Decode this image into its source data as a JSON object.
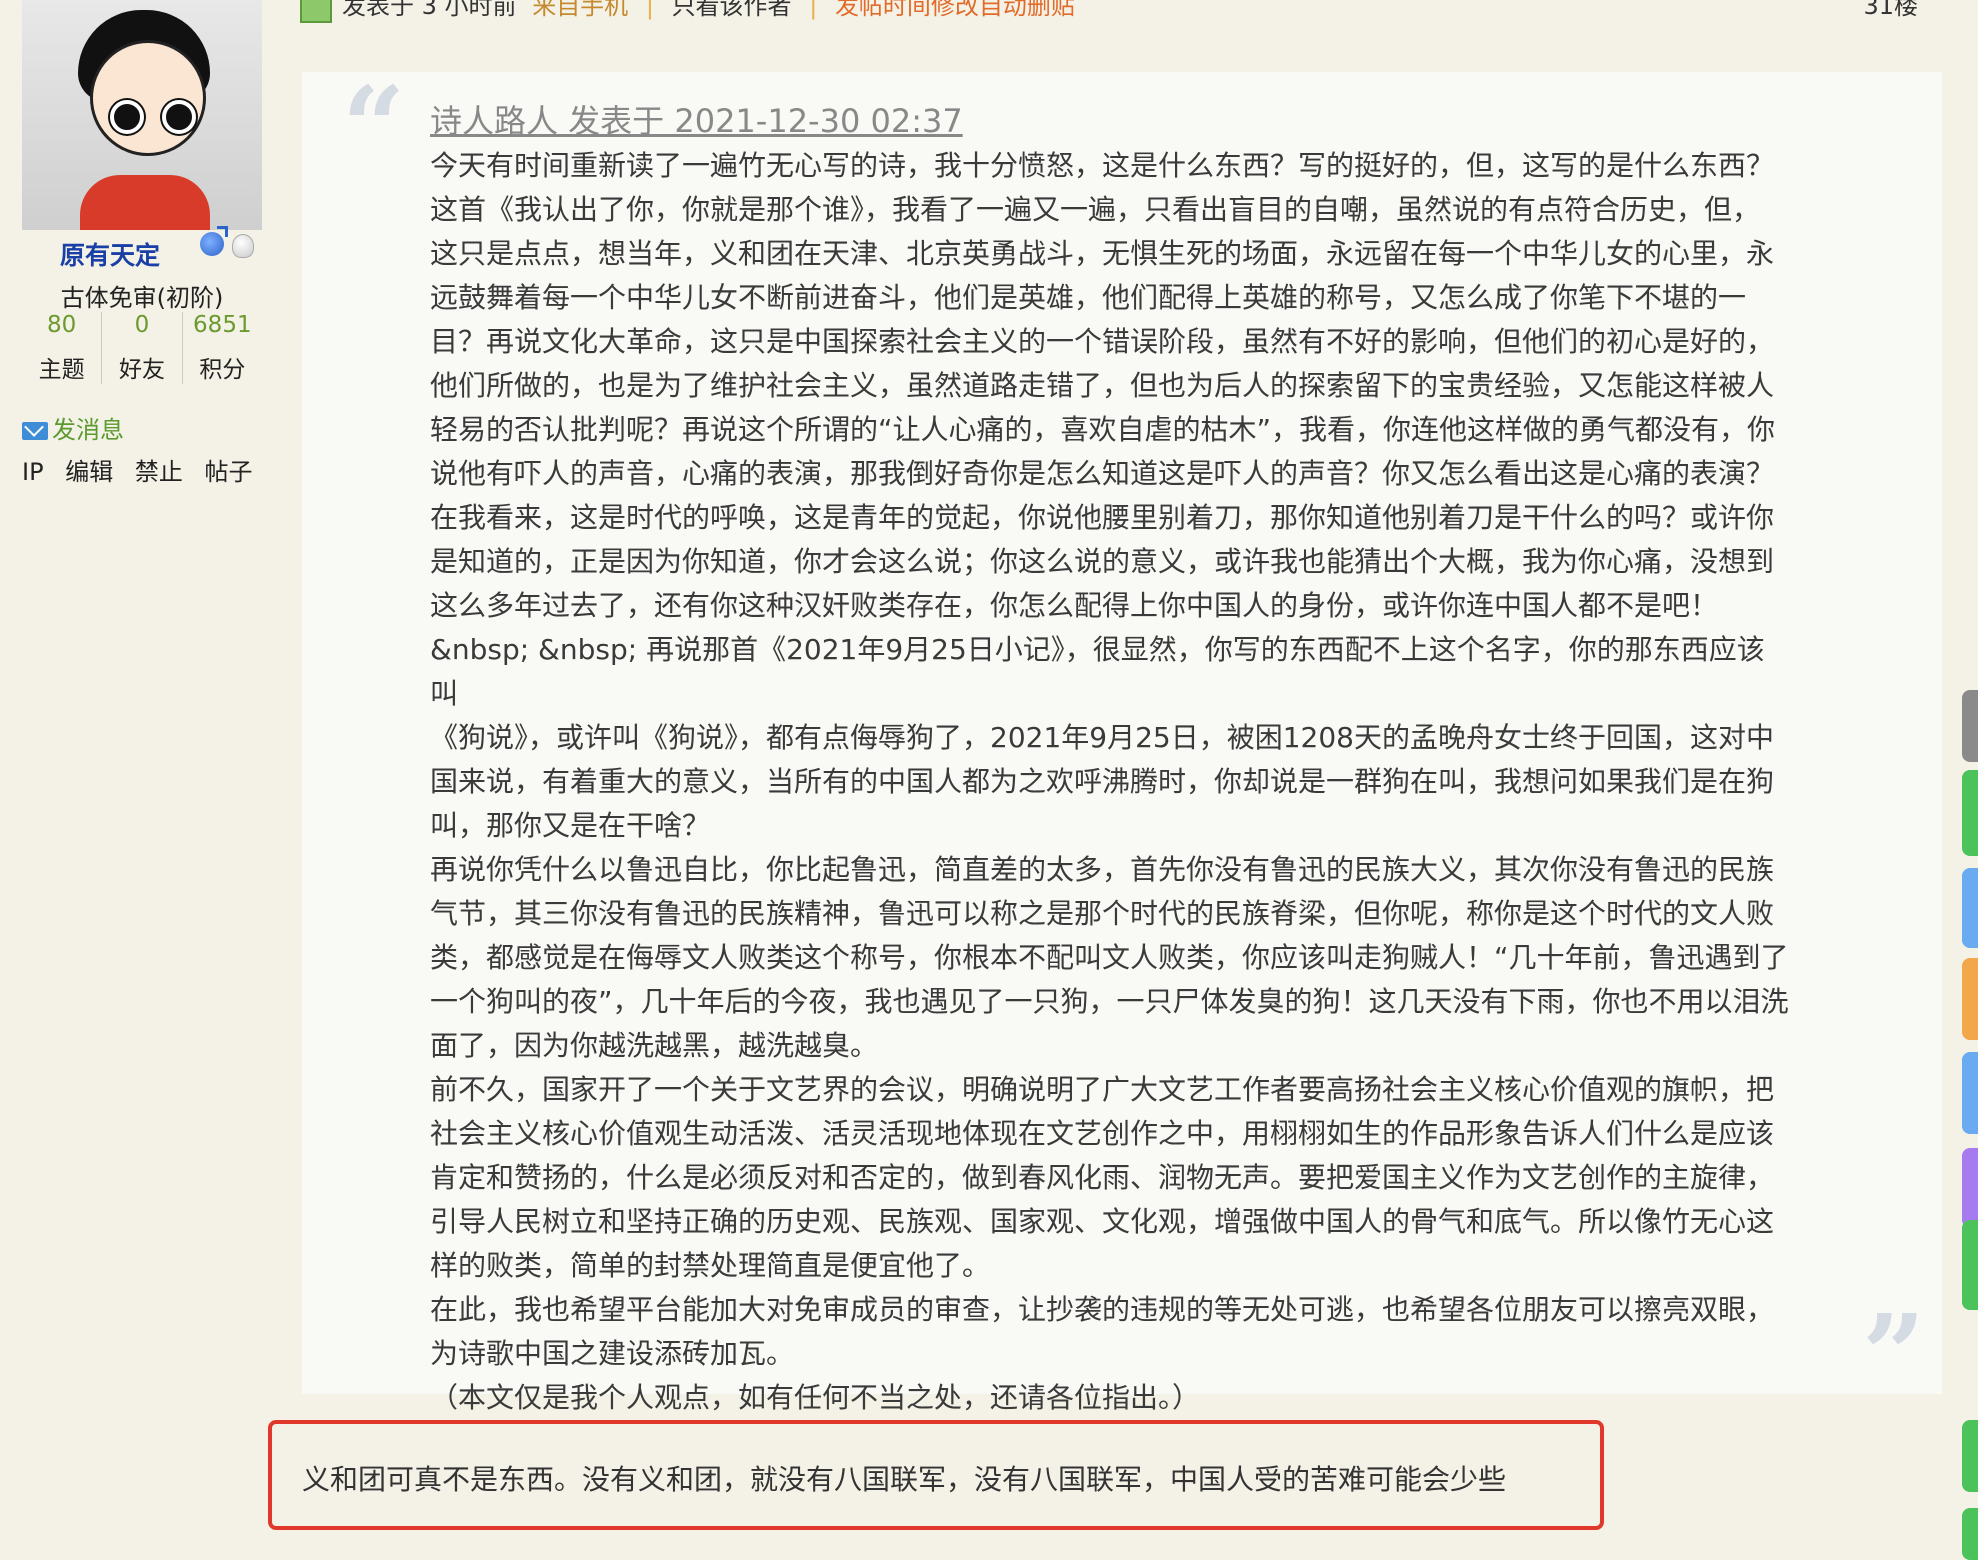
{
  "post_meta": {
    "posted_prefix": "发表于",
    "time_ago": "3 小时前",
    "source": "来自手机",
    "separator": "|",
    "only_author": "只看该作者",
    "edit_notice": "发帖时间修改自动删贴",
    "floor": "31楼"
  },
  "user": {
    "name": "原有天定",
    "rank": "古体免审(初阶)",
    "stats": [
      {
        "value": "80",
        "label": "主题"
      },
      {
        "value": "0",
        "label": "好友"
      },
      {
        "value": "6851",
        "label": "积分"
      }
    ],
    "send_message": "发消息",
    "admin_links": [
      "IP",
      "编辑",
      "禁止",
      "帖子"
    ]
  },
  "quote": {
    "header": "诗人路人 发表于 2021-12-30 02:37",
    "lines": [
      "今天有时间重新读了一遍竹无心写的诗，我十分愤怒，这是什么东西？写的挺好的，但，这写的是什么东西？",
      "这首《我认出了你，你就是那个谁》，我看了一遍又一遍，只看出盲目的自嘲，虽然说的有点符合历史，但，",
      "这只是点点，想当年，义和团在天津、北京英勇战斗，无惧生死的场面，永远留在每一个中华儿女的心里，永",
      "远鼓舞着每一个中华儿女不断前进奋斗，他们是英雄，他们配得上英雄的称号，又怎么成了你笔下不堪的一",
      "目？再说文化大革命，这只是中国探索社会主义的一个错误阶段，虽然有不好的影响，但他们的初心是好的，",
      "他们所做的，也是为了维护社会主义，虽然道路走错了，但也为后人的探索留下的宝贵经验，又怎能这样被人",
      "轻易的否认批判呢？再说这个所谓的“让人心痛的，喜欢自虐的枯木”，我看，你连他这样做的勇气都没有，你",
      "说他有吓人的声音，心痛的表演，那我倒好奇你是怎么知道这是吓人的声音？你又怎么看出这是心痛的表演？",
      "在我看来，这是时代的呼唤，这是青年的觉起，你说他腰里别着刀，那你知道他别着刀是干什么的吗？或许你",
      "是知道的，正是因为你知道，你才会这么说；你这么说的意义，或许我也能猜出个大概，我为你心痛，没想到",
      "这么多年过去了，还有你这种汉奸败类存在，你怎么配得上你中国人的身份，或许你连中国人都不是吧！",
      "&nbsp; &nbsp; 再说那首《2021年9月25日小记》，很显然，你写的东西配不上这个名字，你的那东西应该叫",
      "《狗说》，或许叫《狗说》，都有点侮辱狗了，2021年9月25日，被困1208天的孟晚舟女士终于回国，这对中",
      "国来说，有着重大的意义，当所有的中国人都为之欢呼沸腾时，你却说是一群狗在叫，我想问如果我们是在狗",
      "叫，那你又是在干啥？",
      "再说你凭什么以鲁迅自比，你比起鲁迅，简直差的太多，首先你没有鲁迅的民族大义，其次你没有鲁迅的民族",
      "气节，其三你没有鲁迅的民族精神，鲁迅可以称之是那个时代的民族脊梁，但你呢，称你是这个时代的文人败",
      "类，都感觉是在侮辱文人败类这个称号，你根本不配叫文人败类，你应该叫走狗贼人！“几十年前，鲁迅遇到了",
      "一个狗叫的夜”，几十年后的今夜，我也遇见了一只狗，一只尸体发臭的狗！这几天没有下雨，你也不用以泪洗",
      "面了，因为你越洗越黑，越洗越臭。",
      "前不久，国家开了一个关于文艺界的会议，明确说明了广大文艺工作者要高扬社会主义核心价值观的旗帜，把",
      "社会主义核心价值观生动活泼、活灵活现地体现在文艺创作之中，用栩栩如生的作品形象告诉人们什么是应该",
      "肯定和赞扬的，什么是必须反对和否定的，做到春风化雨、润物无声。要把爱国主义作为文艺创作的主旋律，",
      "引导人民树立和坚持正确的历史观、民族观、国家观、文化观，增强做中国人的骨气和底气。所以像竹无心这",
      "样的败类，简单的封禁处理简直是便宜他了。",
      "在此，我也希望平台能加大对免审成员的审查，让抄袭的违规的等无处可逃，也希望各位朋友可以擦亮双眼，",
      "为诗歌中国之建设添砖加瓦。",
      "（本文仅是我个人观点，如有任何不当之处，还请各位指出。）"
    ]
  },
  "reply": {
    "text": "义和团可真不是东西。没有义和团，就没有八国联军，没有八国联军，中国人受的苦难可能会少些"
  },
  "side_tabs": [
    {
      "color": "#8a8a8a"
    },
    {
      "color": "#4cc25a"
    },
    {
      "color": "#6aaaf0"
    },
    {
      "color": "#f2a84a"
    },
    {
      "color": "#6aaaf0"
    },
    {
      "color": "#a77bf0"
    },
    {
      "color": "#4cc25a"
    },
    {
      "color": "#4cc25a"
    },
    {
      "color": "#4cc25a"
    }
  ]
}
